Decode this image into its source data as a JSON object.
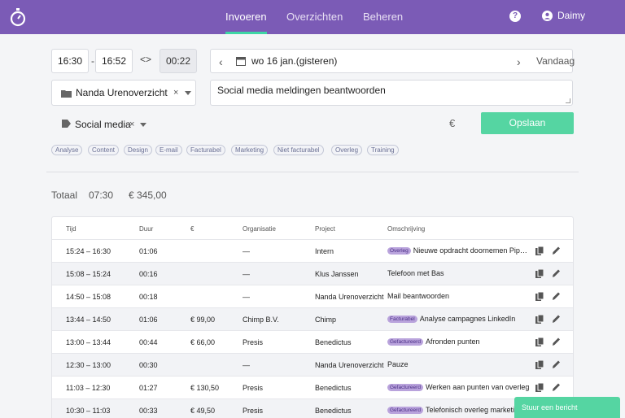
{
  "nav": {
    "tabs": [
      "Invoeren",
      "Overzichten",
      "Beheren"
    ],
    "active": 0,
    "help": "?",
    "user": "Daimy"
  },
  "entry": {
    "start": "16:30",
    "end": "16:52",
    "sep": "-",
    "swap": "<>",
    "duration": "00:22",
    "date": "wo 16 jan.(gisteren)",
    "today": "Vandaag",
    "project": "Nanda Urenoverzicht",
    "description": "Social media meldingen beantwoorden",
    "tag": "Social media",
    "clear": "×",
    "euro": "€",
    "save": "Opslaan"
  },
  "tag_chips": [
    "Analyse",
    "Content",
    "Design",
    "E-mail",
    "Facturabel",
    "Marketing",
    "Niet facturabel",
    "Overleg",
    "Training"
  ],
  "totals": {
    "label": "Totaal",
    "time": "07:30",
    "amount": "€ 345,00"
  },
  "table": {
    "headers": [
      "Tijd",
      "Duur",
      "€",
      "Organisatie",
      "Project",
      "Omschrijving"
    ],
    "rows": [
      {
        "tijd": "15:24 – 16:30",
        "duur": "01:06",
        "bedrag": "",
        "org": "—",
        "project": "Intern",
        "badge": "Overleg",
        "omschrijving": "Nieuwe opdracht doornemen Pipeline"
      },
      {
        "tijd": "15:08 – 15:24",
        "duur": "00:16",
        "bedrag": "",
        "org": "—",
        "project": "Klus Janssen",
        "badge": "",
        "omschrijving": "Telefoon met Bas"
      },
      {
        "tijd": "14:50 – 15:08",
        "duur": "00:18",
        "bedrag": "",
        "org": "—",
        "project": "Nanda Urenoverzicht",
        "badge": "",
        "omschrijving": "Mail beantwoorden"
      },
      {
        "tijd": "13:44 – 14:50",
        "duur": "01:06",
        "bedrag": "€ 99,00",
        "org": "Chimp B.V.",
        "project": "Chimp",
        "badge": "Facturabel",
        "omschrijving": "Analyse campagnes LinkedIn"
      },
      {
        "tijd": "13:00 – 13:44",
        "duur": "00:44",
        "bedrag": "€ 66,00",
        "org": "Presis",
        "project": "Benedictus",
        "badge": "Gefactureerd",
        "omschrijving": "Afronden punten"
      },
      {
        "tijd": "12:30 – 13:00",
        "duur": "00:30",
        "bedrag": "",
        "org": "—",
        "project": "Nanda Urenoverzicht",
        "badge": "",
        "omschrijving": "Pauze"
      },
      {
        "tijd": "11:03 – 12:30",
        "duur": "01:27",
        "bedrag": "€ 130,50",
        "org": "Presis",
        "project": "Benedictus",
        "badge": "Gefactureerd",
        "omschrijving": "Werken aan punten van overleg"
      },
      {
        "tijd": "10:30 – 11:03",
        "duur": "00:33",
        "bedrag": "€ 49,50",
        "org": "Presis",
        "project": "Benedictus",
        "badge": "Gefactureerd",
        "omschrijving": "Telefonisch overleg marketing"
      }
    ]
  },
  "chat": "Stuur een bericht",
  "colors": {
    "header": "#7b5bb6",
    "accent": "#55d5a2",
    "active_underline": "#3ed6a5",
    "badge": "#b9a3dc"
  },
  "icons": [
    "stopwatch-icon",
    "help-icon",
    "user-icon",
    "calendar-icon",
    "folder-icon",
    "tag-icon",
    "euro-icon",
    "copy-icon",
    "edit-icon"
  ]
}
